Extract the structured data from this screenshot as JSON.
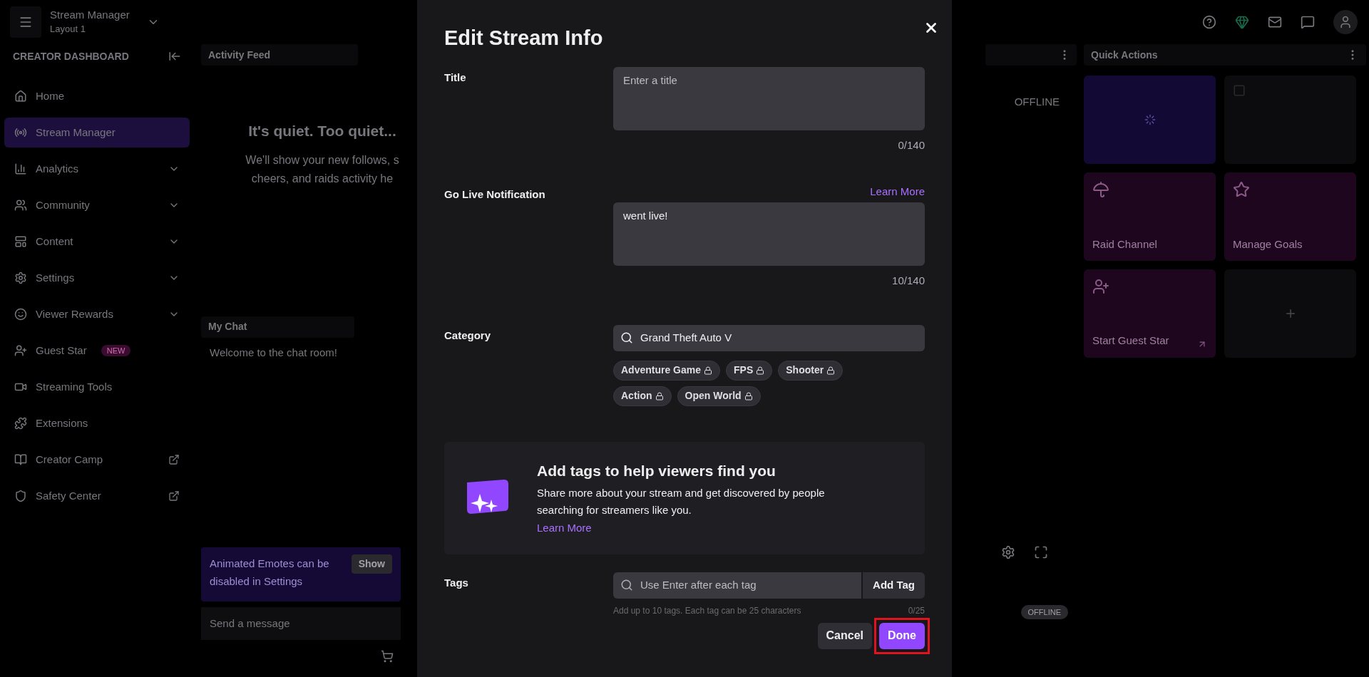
{
  "top_bar": {
    "title": "Stream Manager",
    "subtitle": "Layout 1"
  },
  "sidebar": {
    "heading": "CREATOR DASHBOARD",
    "items": [
      {
        "label": "Home",
        "kind": "plain",
        "selected": false
      },
      {
        "label": "Stream Manager",
        "kind": "plain",
        "selected": true
      },
      {
        "label": "Analytics",
        "kind": "expand",
        "selected": false
      },
      {
        "label": "Community",
        "kind": "expand",
        "selected": false
      },
      {
        "label": "Content",
        "kind": "expand",
        "selected": false
      },
      {
        "label": "Settings",
        "kind": "expand",
        "selected": false
      },
      {
        "label": "Viewer Rewards",
        "kind": "expand",
        "selected": false
      },
      {
        "label": "Guest Star",
        "kind": "plain",
        "selected": false,
        "badge": "NEW"
      },
      {
        "label": "Streaming Tools",
        "kind": "plain",
        "selected": false
      },
      {
        "label": "Extensions",
        "kind": "plain",
        "selected": false
      },
      {
        "label": "Creator Camp",
        "kind": "external",
        "selected": false
      },
      {
        "label": "Safety Center",
        "kind": "external",
        "selected": false
      }
    ]
  },
  "activity_feed": {
    "title": "Activity Feed",
    "empty_title": "It's quiet. Too quiet...",
    "empty_text": "We'll show your new follows, s cheers, and raids activity he"
  },
  "chat": {
    "title": "My Chat",
    "welcome": "Welcome to the chat room!",
    "notice": "Animated Emotes can be disabled in Settings",
    "notice_button": "Show",
    "placeholder": "Send a message"
  },
  "stream_preview": {
    "status": "OFFLINE",
    "badge": "OFFLINE"
  },
  "quick_actions": {
    "title": "Quick Actions",
    "cards": [
      {
        "kind": "loading"
      },
      {
        "kind": "blank"
      },
      {
        "kind": "raid",
        "label": "Raid Channel"
      },
      {
        "kind": "goals",
        "label": "Manage Goals"
      },
      {
        "kind": "guest",
        "label": "Start Guest Star"
      },
      {
        "kind": "add"
      }
    ]
  },
  "modal": {
    "title": "Edit Stream Info",
    "title_field": {
      "label": "Title",
      "placeholder": "Enter a title",
      "count": "0/140"
    },
    "notification_field": {
      "label": "Go Live Notification",
      "link": "Learn More",
      "value": "went live!",
      "count": "10/140"
    },
    "category_field": {
      "label": "Category",
      "value": "Grand Theft Auto V",
      "tags": [
        "Adventure Game",
        "FPS",
        "Shooter",
        "Action",
        "Open World"
      ]
    },
    "promo": {
      "heading": "Add tags to help viewers find you",
      "text": "Share more about your stream and get discovered by people searching for streamers like you.",
      "link": "Learn More"
    },
    "tags_field": {
      "label": "Tags",
      "placeholder": "Use Enter after each tag",
      "button": "Add Tag",
      "hint": "Add up to 10 tags. Each tag can be 25 characters",
      "count": "0/25"
    },
    "buttons": {
      "cancel": "Cancel",
      "done": "Done"
    },
    "highlight_done": true
  }
}
